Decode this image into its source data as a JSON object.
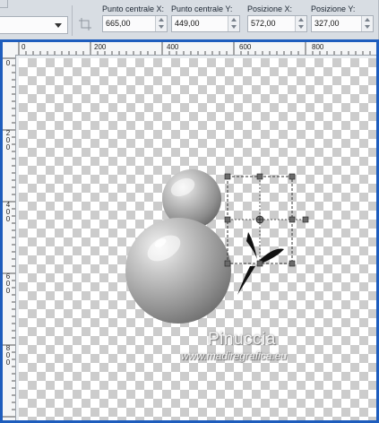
{
  "toolbar": {
    "fields": [
      {
        "label": "Punto centrale X:",
        "value": "665,00"
      },
      {
        "label": "Punto centrale Y:",
        "value": "449,00"
      },
      {
        "label": "Posizione X:",
        "value": "572,00"
      },
      {
        "label": "Posizione Y:",
        "value": "327,00"
      }
    ]
  },
  "ruler": {
    "horizontal": [
      "0",
      "200",
      "400",
      "600",
      "800"
    ],
    "vertical": [
      "0",
      "200",
      "400",
      "600",
      "800"
    ]
  },
  "watermark": {
    "name": "Pinuccia",
    "url": "www.madiregrafica.eu"
  },
  "colors": {
    "window_frame": "#1e5dbd",
    "toolbar_bg": "#d8dde3",
    "checker_dark": "#cccccc"
  }
}
